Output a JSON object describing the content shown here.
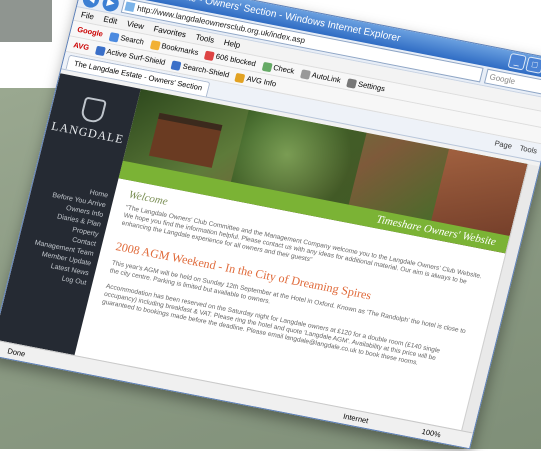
{
  "window": {
    "title": "The Langdale Estate - Owners' Section - Windows Internet Explorer",
    "minimize": "_",
    "maximize": "□",
    "close": "x"
  },
  "addressbar": {
    "url": "http://www.langdaleownersclub.org.uk/index.asp",
    "search_placeholder": "Google"
  },
  "menu": [
    "File",
    "Edit",
    "View",
    "Favorites",
    "Tools",
    "Help"
  ],
  "toolbar": {
    "brand": "Google",
    "items": [
      "Search",
      "Bookmarks",
      "606 blocked",
      "Check",
      "AutoLink",
      "Settings"
    ]
  },
  "avg_toolbar": {
    "brand": "AVG",
    "items": [
      "Active Surf-Shield",
      "Search-Shield",
      "AVG Info"
    ]
  },
  "tabs": [
    {
      "label": "The Langdale Estate - Owners' Section"
    }
  ],
  "tab_tools": [
    "Page",
    "Tools"
  ],
  "sidebar": {
    "brand": "LANGDALE",
    "nav": [
      "Home",
      "Before You Arrive",
      "Owners Info",
      "Diaries & Plan",
      "Property",
      "Contact",
      "Management Team",
      "Member Update",
      "Latest News",
      "Log Out"
    ]
  },
  "banner": {
    "strip_text": "Timeshare Owners' Website"
  },
  "main": {
    "welcome": "Welcome",
    "intro": "\"The Langdale Owners' Club Committee and the Management Company welcome you to the Langdale Owners' Club Website. We hope you find the information helpful. Please contact us with any ideas for additional material. Our aim is always to be enhancing the Langdale experience for all owners and their guests\"",
    "heading": "2008 AGM Weekend - In the City of Dreaming Spires",
    "para1": "This year's AGM will be held on Sunday 12th September at the Hotel in Oxford. Known as 'The Randolph' the hotel is close to the city centre. Parking is limited but available to owners.",
    "para2": "Accommodation has been reserved on the Saturday night for Langdale owners at £120 for a double room (£140 single occupancy) including breakfast & VAT. Please ring the hotel and quote 'Langdale AGM'. Availability at this price will be guaranteed to bookings made before the deadline. Please email langdale@langdale.co.uk to book these rooms."
  },
  "status": {
    "left": "Done",
    "zone": "Internet",
    "zoom": "100%"
  }
}
